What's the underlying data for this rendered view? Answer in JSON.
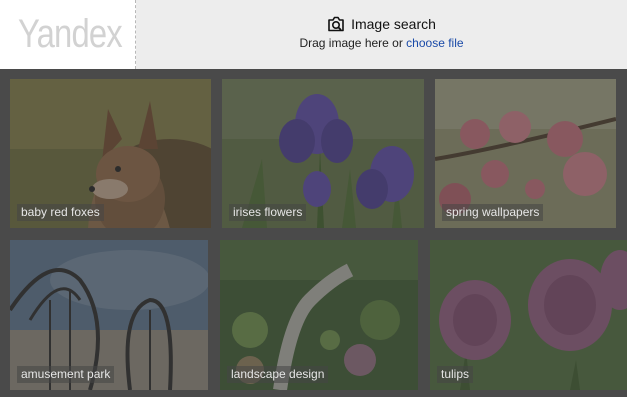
{
  "header": {
    "logo_text": "Yandex",
    "search_title": "Image search",
    "drag_prefix": "Drag image here or ",
    "choose_file": "choose file"
  },
  "tiles": [
    {
      "label": "baby red foxes"
    },
    {
      "label": "irises flowers"
    },
    {
      "label": "spring wallpapers"
    },
    {
      "label": "amusement park"
    },
    {
      "label": "landscape design"
    },
    {
      "label": "tulips"
    }
  ],
  "colors": {
    "background": "#4a4a4a",
    "header_bg": "#ededed",
    "link": "#1a4aa8"
  }
}
